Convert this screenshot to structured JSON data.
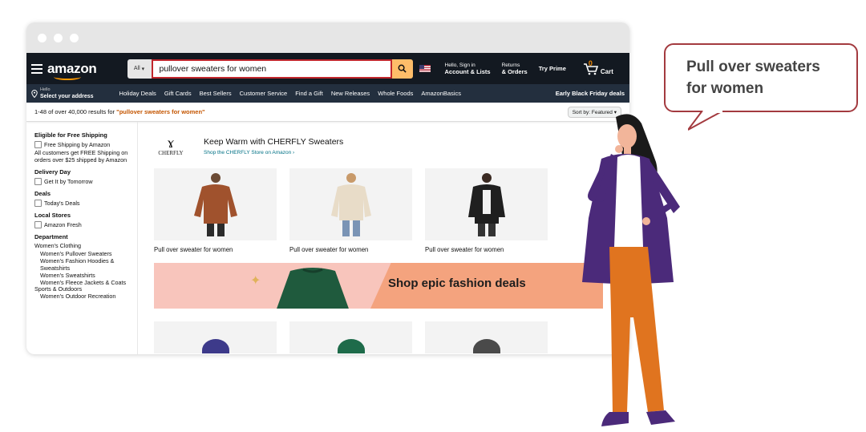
{
  "browser": {
    "dots": 3
  },
  "nav": {
    "logo": "amazon",
    "search_category": "All",
    "search_query": "pullover sweaters for women",
    "account_line1": "Hello, Sign in",
    "account_line2": "Account & Lists",
    "returns_line1": "Returns",
    "returns_line2": "& Orders",
    "prime": "Try Prime",
    "cart_count": "0",
    "cart_label": "Cart",
    "address_line1": "Hello",
    "address_line2": "Select your address",
    "links": [
      "Holiday Deals",
      "Gift Cards",
      "Best Sellers",
      "Customer Service",
      "Find a Gift",
      "New Releases",
      "Whole Foods",
      "AmazonBasics"
    ],
    "black_friday": "Early Black Friday deals"
  },
  "results": {
    "prefix": "1-48 of over 40,000 results for ",
    "query": "\"pullover sweaters for women\"",
    "sort": "Sort by: Featured"
  },
  "sidebar": {
    "shipping_heading": "Eligible for Free Shipping",
    "shipping_option": "Free Shipping by Amazon",
    "shipping_note": "All customers get FREE Shipping on orders over $25 shipped by Amazon",
    "delivery_heading": "Delivery Day",
    "delivery_option": "Get It by Tomorrow",
    "deals_heading": "Deals",
    "deals_option": "Today's Deals",
    "stores_heading": "Local Stores",
    "stores_option": "Amazon Fresh",
    "department_heading": "Department",
    "dept_top": "Women's Clothing",
    "dept_items": [
      "Women's Pullover Sweaters",
      "Women's Fashion Hoodies & Sweatshirts",
      "Women's Sweatshirts",
      "Women's Fleece Jackets & Coats"
    ],
    "dept_top2": "Sports & Outdoors",
    "dept_items2": [
      "Women's Outdoor Recreation"
    ]
  },
  "brand": {
    "logo_text": "CHERFLY",
    "title": "Keep Warm with CHERFLY Sweaters",
    "link": "Shop the CHERFLY Store on Amazon ›"
  },
  "products": [
    {
      "title": "Pull over sweater for women",
      "color": "#a0522d"
    },
    {
      "title": "Pull over sweater for women",
      "color": "#e8dcc8"
    },
    {
      "title": "Pull over sweater for women",
      "color": "#1f1f1f"
    }
  ],
  "banner": {
    "text": "Shop epic fashion deals",
    "sweater_color": "#1f5a3d"
  },
  "products_row2_colors": [
    "#3d3a8a",
    "#1e6b4a",
    "#4a4a4a"
  ],
  "bubble": {
    "line1": "Pull over sweaters",
    "line2": "for women"
  },
  "colors": {
    "nav_dark": "#131921",
    "nav_secondary": "#232f3e",
    "search_button": "#febd69",
    "highlight_border": "#c1272d",
    "bubble_border": "#a33a3f"
  }
}
